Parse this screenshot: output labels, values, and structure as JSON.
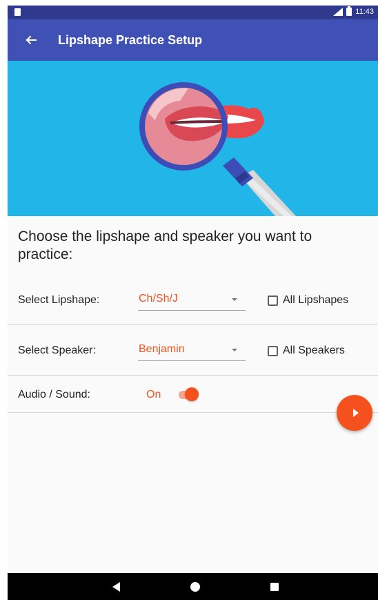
{
  "status_bar": {
    "time": "11:43",
    "icons": [
      "sd-card-icon",
      "signal-icon",
      "battery-icon"
    ]
  },
  "app_bar": {
    "back_icon": "arrow-back-icon",
    "title": "Lipshape Practice Setup"
  },
  "hero": {
    "illustration": "magnifying-glass-lips-illustration",
    "colors": {
      "background": "#22b5e8",
      "lips": "#e8474c",
      "lens_rim": "#3d4db8"
    }
  },
  "main": {
    "prompt": "Choose the lipshape and speaker you want to practice:",
    "lipshape": {
      "label": "Select Lipshape:",
      "value": "Ch/Sh/J",
      "checkbox_label": "All Lipshapes",
      "checkbox_checked": false
    },
    "speaker": {
      "label": "Select Speaker:",
      "value": "Benjamin",
      "checkbox_label": "All Speakers",
      "checkbox_checked": false
    },
    "audio": {
      "label": "Audio / Sound:",
      "value": "On",
      "toggle_on": true
    },
    "fab_icon": "play-icon"
  },
  "nav_bar": {
    "icons": [
      "back-triangle-icon",
      "home-circle-icon",
      "recents-square-icon"
    ]
  },
  "colors": {
    "primary": "#3f51b5",
    "primary_dark": "#2f3a8f",
    "accent": "#f4511e"
  }
}
